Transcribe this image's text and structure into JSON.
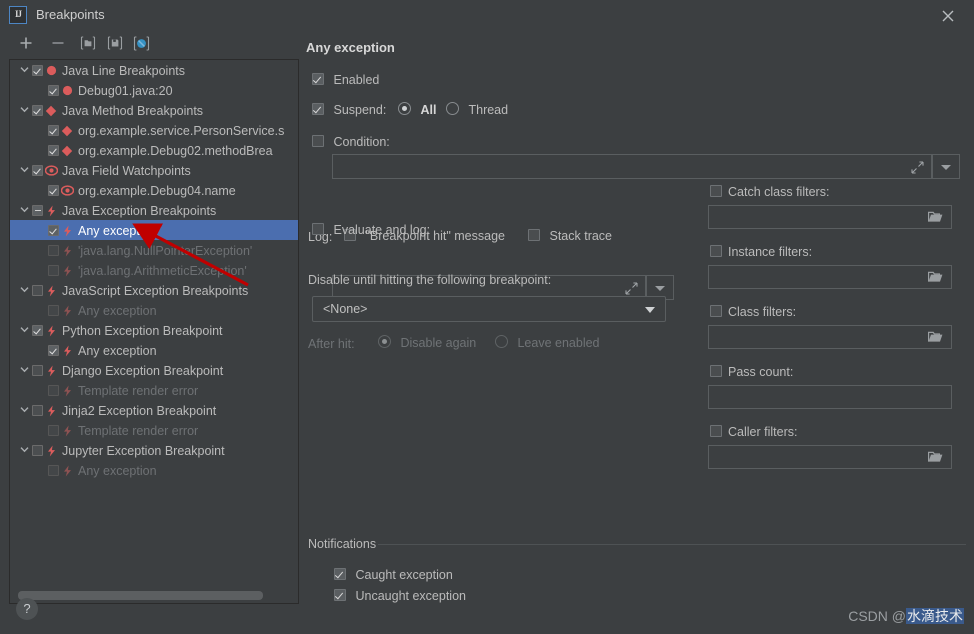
{
  "window": {
    "title": "Breakpoints",
    "logo_text": "IJ",
    "close_icon": "close-icon"
  },
  "toolbar": {
    "items": [
      {
        "name": "add-breakpoint-button",
        "icon": "plus-icon",
        "label": "+"
      },
      {
        "name": "remove-breakpoint-button",
        "icon": "minus-icon",
        "label": "−"
      },
      {
        "name": "group-breakpoints-button",
        "icon": "folder-icon",
        "label": ""
      },
      {
        "name": "save-breakpoints-button",
        "icon": "save-icon",
        "label": ""
      },
      {
        "name": "mute-breakpoints-button",
        "icon": "mute-breakpoints-icon",
        "label": ""
      }
    ]
  },
  "tree": {
    "nodes": [
      {
        "label": "Java Line Breakpoints",
        "level": 0,
        "expander": "chevron-down-icon",
        "checked": "checked",
        "icon": "breakpoint-circle-icon",
        "dim": false
      },
      {
        "label": "Debug01.java:20",
        "level": 1,
        "expander": "none",
        "checked": "checked",
        "icon": "breakpoint-circle-icon",
        "dim": false
      },
      {
        "label": "Java Method Breakpoints",
        "level": 0,
        "expander": "chevron-down-icon",
        "checked": "checked",
        "icon": "method-breakpoint-icon",
        "dim": false
      },
      {
        "label": "org.example.service.PersonService.s",
        "level": 1,
        "expander": "none",
        "checked": "checked",
        "icon": "method-breakpoint-icon",
        "dim": false
      },
      {
        "label": "org.example.Debug02.methodBrea",
        "level": 1,
        "expander": "none",
        "checked": "checked",
        "icon": "method-breakpoint-icon",
        "dim": false
      },
      {
        "label": "Java Field Watchpoints",
        "level": 0,
        "expander": "chevron-down-icon",
        "checked": "checked",
        "icon": "field-watchpoint-icon",
        "dim": false
      },
      {
        "label": "org.example.Debug04.name",
        "level": 1,
        "expander": "none",
        "checked": "checked",
        "icon": "field-watchpoint-icon",
        "dim": false
      },
      {
        "label": "Java Exception Breakpoints",
        "level": 0,
        "expander": "chevron-down-icon",
        "checked": "indeterminate",
        "icon": "exception-breakpoint-icon",
        "dim": false
      },
      {
        "label": "Any exception",
        "level": 1,
        "expander": "none",
        "checked": "checked",
        "icon": "exception-breakpoint-icon",
        "dim": false,
        "selected": true
      },
      {
        "label": "'java.lang.NullPointerException'",
        "level": 1,
        "expander": "none",
        "checked": "unchecked",
        "icon": "exception-breakpoint-icon",
        "dim": true
      },
      {
        "label": "'java.lang.ArithmeticException'",
        "level": 1,
        "expander": "none",
        "checked": "unchecked",
        "icon": "exception-breakpoint-icon",
        "dim": true
      },
      {
        "label": "JavaScript Exception Breakpoints",
        "level": 0,
        "expander": "chevron-down-icon",
        "checked": "unchecked",
        "icon": "exception-breakpoint-icon",
        "dim": false
      },
      {
        "label": "Any exception",
        "level": 1,
        "expander": "none",
        "checked": "unchecked",
        "icon": "exception-breakpoint-icon",
        "dim": true
      },
      {
        "label": "Python Exception Breakpoint",
        "level": 0,
        "expander": "chevron-down-icon",
        "checked": "checked",
        "icon": "exception-breakpoint-icon",
        "dim": false
      },
      {
        "label": "Any exception",
        "level": 1,
        "expander": "none",
        "checked": "checked",
        "icon": "exception-breakpoint-icon",
        "dim": false
      },
      {
        "label": "Django Exception Breakpoint",
        "level": 0,
        "expander": "chevron-down-icon",
        "checked": "unchecked",
        "icon": "exception-breakpoint-icon",
        "dim": false
      },
      {
        "label": "Template render error",
        "level": 1,
        "expander": "none",
        "checked": "unchecked",
        "icon": "exception-breakpoint-icon",
        "dim": true
      },
      {
        "label": "Jinja2 Exception Breakpoint",
        "level": 0,
        "expander": "chevron-down-icon",
        "checked": "unchecked",
        "icon": "exception-breakpoint-icon",
        "dim": false
      },
      {
        "label": "Template render error",
        "level": 1,
        "expander": "none",
        "checked": "unchecked",
        "icon": "exception-breakpoint-icon",
        "dim": true
      },
      {
        "label": "Jupyter Exception Breakpoint",
        "level": 0,
        "expander": "chevron-down-icon",
        "checked": "unchecked",
        "icon": "exception-breakpoint-icon",
        "dim": false
      },
      {
        "label": "Any exception",
        "level": 1,
        "expander": "none",
        "checked": "unchecked",
        "icon": "exception-breakpoint-icon",
        "dim": true
      }
    ]
  },
  "details": {
    "header": "Any exception",
    "enabled": {
      "label": "Enabled",
      "checked": true
    },
    "suspend": {
      "label": "Suspend:",
      "checked": true,
      "options": [
        {
          "label": "All",
          "selected": true
        },
        {
          "label": "Thread",
          "selected": false
        }
      ]
    },
    "condition": {
      "label": "Condition:",
      "checked": false,
      "value": "",
      "expand_icon": "expand-icon",
      "dropdown_icon": "chevron-down-icon"
    },
    "log": {
      "label": "Log:",
      "breakpoint_hit": {
        "label": "\"Breakpoint hit\" message",
        "checked": false
      },
      "stack_trace": {
        "label": "Stack trace",
        "checked": false
      }
    },
    "evaluate_and_log": {
      "label": "Evaluate and log:",
      "checked": false,
      "value": "",
      "expand_icon": "expand-icon",
      "dropdown_icon": "chevron-down-icon"
    },
    "disable_until": {
      "label": "Disable until hitting the following breakpoint:",
      "selected": "<None>",
      "after_hit": {
        "label": "After hit:",
        "options": [
          {
            "label": "Disable again",
            "selected": true
          },
          {
            "label": "Leave enabled",
            "selected": false
          }
        ]
      }
    },
    "filters": [
      {
        "label": "Catch class filters:",
        "checked": false,
        "value": "",
        "has_browse": true,
        "browse_icon": "folder-icon"
      },
      {
        "label": "Instance filters:",
        "checked": false,
        "value": "",
        "has_browse": true,
        "browse_icon": "folder-icon"
      },
      {
        "label": "Class filters:",
        "checked": false,
        "value": "",
        "has_browse": true,
        "browse_icon": "folder-icon"
      },
      {
        "label": "Pass count:",
        "checked": false,
        "value": "",
        "has_browse": false
      },
      {
        "label": "Caller filters:",
        "checked": false,
        "value": "",
        "has_browse": true,
        "browse_icon": "folder-icon"
      }
    ],
    "notifications": {
      "title": "Notifications",
      "items": [
        {
          "label": "Caught exception",
          "checked": true
        },
        {
          "label": "Uncaught exception",
          "checked": true
        }
      ]
    }
  },
  "help_button": {
    "label": "?"
  },
  "watermark": {
    "prefix": "CSDN @",
    "highlighted": "水滴技术"
  },
  "colors": {
    "background": "#3c3f41",
    "selection": "#4b6eaf",
    "breakpoint_red": "#db5c5c",
    "accent_blue": "#3592c4",
    "annotation_red": "#c00000",
    "text": "#bbbbbb",
    "text_dim": "#6f7376"
  }
}
